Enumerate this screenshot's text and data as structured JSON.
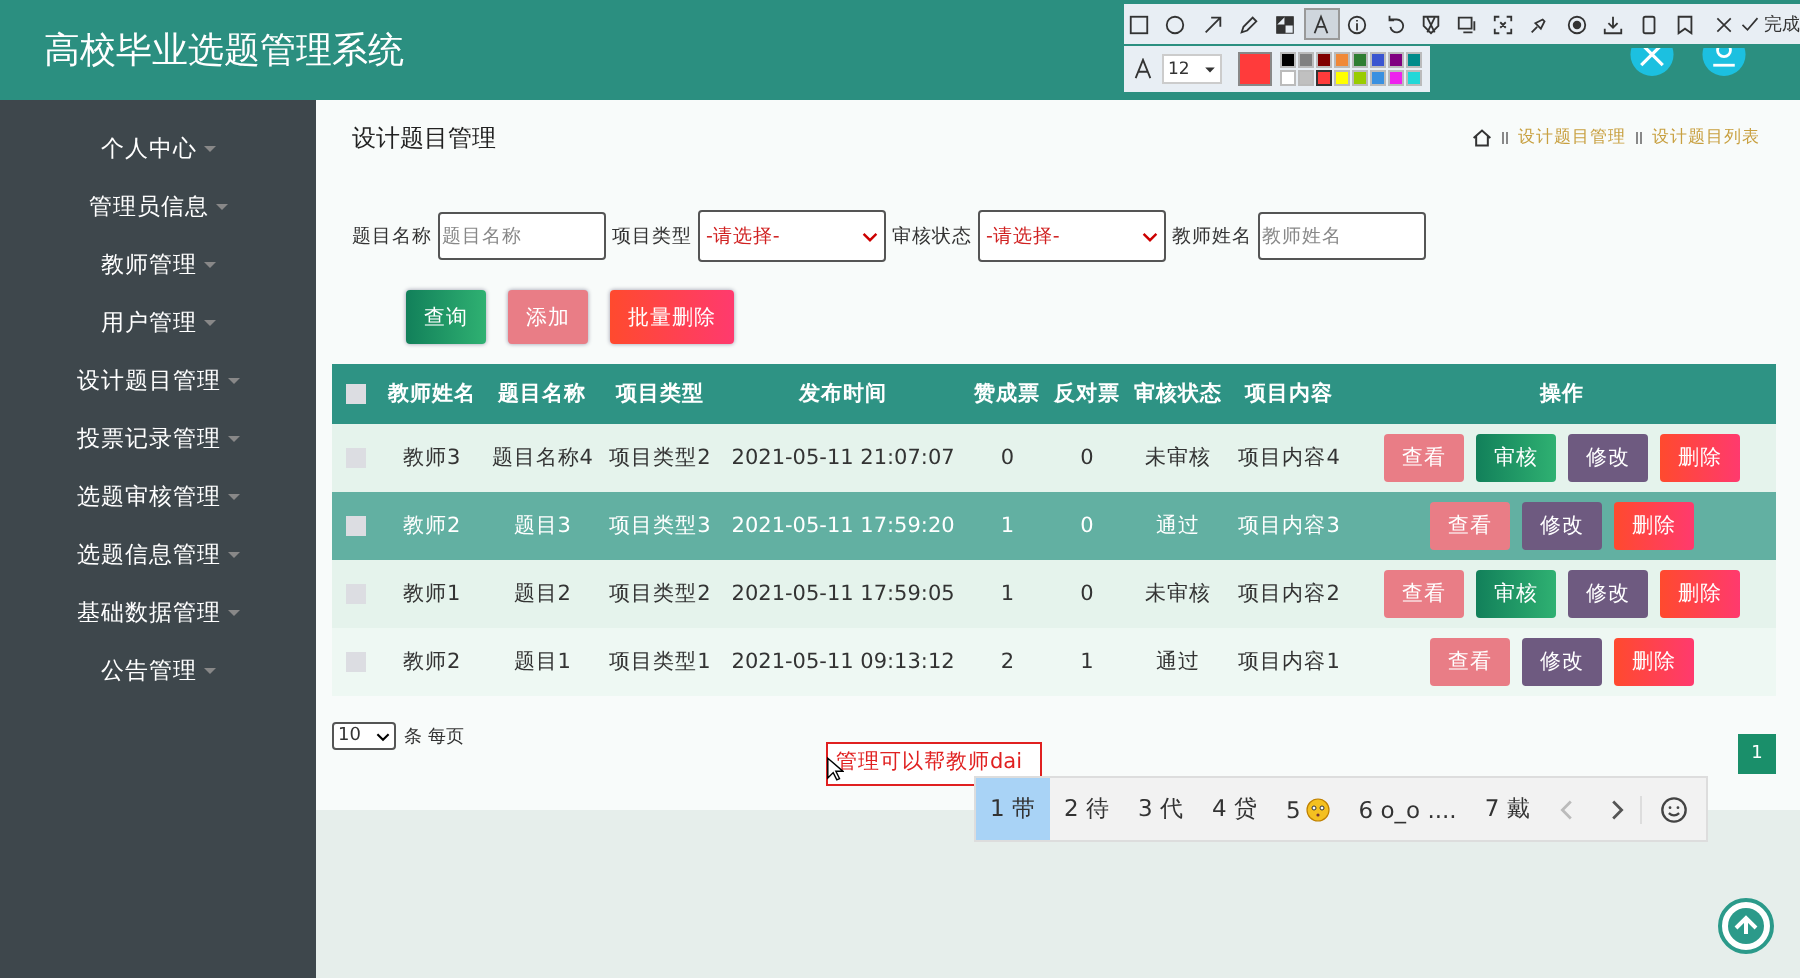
{
  "header": {
    "title": "高校毕业选题管理系统"
  },
  "sidebar": {
    "items": [
      {
        "label": "个人中心"
      },
      {
        "label": "管理员信息"
      },
      {
        "label": "教师管理"
      },
      {
        "label": "用户管理"
      },
      {
        "label": "设计题目管理"
      },
      {
        "label": "投票记录管理"
      },
      {
        "label": "选题审核管理"
      },
      {
        "label": "选题信息管理"
      },
      {
        "label": "基础数据管理"
      },
      {
        "label": "公告管理"
      }
    ]
  },
  "page": {
    "title": "设计题目管理",
    "breadcrumb": [
      "设计题目管理",
      "设计题目列表"
    ]
  },
  "filters": [
    {
      "kind": "input",
      "label": "题目名称",
      "placeholder": "题目名称"
    },
    {
      "kind": "select",
      "label": "项目类型",
      "value": "-请选择-"
    },
    {
      "kind": "select",
      "label": "审核状态",
      "value": "-请选择-"
    },
    {
      "kind": "input",
      "label": "教师姓名",
      "placeholder": "教师姓名"
    }
  ],
  "buttons": [
    {
      "kind": "query",
      "label": "查询"
    },
    {
      "kind": "add",
      "label": "添加"
    },
    {
      "kind": "delete",
      "label": "批量删除"
    }
  ],
  "table": {
    "all_checked": false,
    "columns": [
      "教师姓名",
      "题目名称",
      "项目类型",
      "发布时间",
      "赞成票",
      "反对票",
      "审核状态",
      "项目内容",
      "操作"
    ],
    "rows": [
      {
        "selected": false,
        "checked": false,
        "cells": [
          "教师3",
          "题目名称4",
          "项目类型2",
          "2021-05-11 21:07:07",
          "0",
          "0",
          "未审核",
          "项目内容4"
        ],
        "actions": [
          {
            "kind": "view",
            "label": "查看"
          },
          {
            "kind": "audit",
            "label": "审核"
          },
          {
            "kind": "edit",
            "label": "修改"
          },
          {
            "kind": "delete",
            "label": "删除"
          }
        ]
      },
      {
        "selected": true,
        "checked": false,
        "cells": [
          "教师2",
          "题目3",
          "项目类型3",
          "2021-05-11 17:59:20",
          "1",
          "0",
          "通过",
          "项目内容3"
        ],
        "actions": [
          {
            "kind": "view",
            "label": "查看"
          },
          {
            "kind": "edit",
            "label": "修改"
          },
          {
            "kind": "delete",
            "label": "删除"
          }
        ]
      },
      {
        "selected": false,
        "checked": false,
        "cells": [
          "教师1",
          "题目2",
          "项目类型2",
          "2021-05-11 17:59:05",
          "1",
          "0",
          "未审核",
          "项目内容2"
        ],
        "actions": [
          {
            "kind": "view",
            "label": "查看"
          },
          {
            "kind": "audit",
            "label": "审核"
          },
          {
            "kind": "edit",
            "label": "修改"
          },
          {
            "kind": "delete",
            "label": "删除"
          }
        ]
      },
      {
        "selected": false,
        "checked": false,
        "cells": [
          "教师2",
          "题目1",
          "项目类型1",
          "2021-05-11 09:13:12",
          "2",
          "1",
          "通过",
          "项目内容1"
        ],
        "actions": [
          {
            "kind": "view",
            "label": "查看"
          },
          {
            "kind": "edit",
            "label": "修改"
          },
          {
            "kind": "delete",
            "label": "删除"
          }
        ]
      }
    ]
  },
  "pagination": {
    "page_size": "10",
    "page_size_label": "条 每页",
    "pages": [
      {
        "label": "1",
        "selected": true
      }
    ]
  },
  "annotation": {
    "text": "管理可以帮教师dai"
  },
  "ime": {
    "candidates": [
      {
        "kind": "text",
        "label": "1 带",
        "selected": true
      },
      {
        "kind": "text",
        "label": "2 待",
        "selected": false
      },
      {
        "kind": "text",
        "label": "3 代",
        "selected": false
      },
      {
        "kind": "text",
        "label": "4 贷",
        "selected": false
      },
      {
        "kind": "emoji",
        "label": "5",
        "selected": false
      },
      {
        "kind": "text",
        "label": "6 o_o ....",
        "selected": false
      },
      {
        "kind": "text",
        "label": "7 戴",
        "selected": false
      }
    ]
  },
  "toolbar": {
    "tools": [
      {
        "kind": "rect",
        "selected": false
      },
      {
        "kind": "circle",
        "selected": false
      },
      {
        "kind": "arrow",
        "selected": false
      },
      {
        "kind": "pencil",
        "selected": false
      },
      {
        "kind": "mosaic",
        "selected": false
      },
      {
        "kind": "text",
        "selected": true
      },
      {
        "kind": "number",
        "selected": false
      },
      {
        "kind": "undo",
        "selected": false
      },
      {
        "kind": "crop",
        "selected": false
      },
      {
        "kind": "screen",
        "selected": false
      },
      {
        "kind": "frame",
        "selected": false
      },
      {
        "kind": "pin",
        "selected": false
      },
      {
        "kind": "record",
        "selected": false
      },
      {
        "kind": "download",
        "selected": false
      },
      {
        "kind": "phone",
        "selected": false
      },
      {
        "kind": "bookmark",
        "selected": false
      }
    ],
    "done_label": "完成",
    "font_size": "12",
    "colors": [
      {
        "color": "#000000",
        "selected": false
      },
      {
        "color": "#808080",
        "selected": false
      },
      {
        "color": "#800000",
        "selected": false
      },
      {
        "color": "#f08838",
        "selected": false
      },
      {
        "color": "#2e7d32",
        "selected": false
      },
      {
        "color": "#3a55d0",
        "selected": false
      },
      {
        "color": "#800080",
        "selected": false
      },
      {
        "color": "#008b8b",
        "selected": false
      },
      {
        "color": "#ffffff",
        "selected": false
      },
      {
        "color": "#c0c0c0",
        "selected": false
      },
      {
        "color": "#ff3b3b",
        "selected": true
      },
      {
        "color": "#ffff00",
        "selected": false
      },
      {
        "color": "#99cc00",
        "selected": false
      },
      {
        "color": "#3a90e0",
        "selected": false
      },
      {
        "color": "#ee22ee",
        "selected": false
      },
      {
        "color": "#22d8d8",
        "selected": false
      }
    ]
  }
}
